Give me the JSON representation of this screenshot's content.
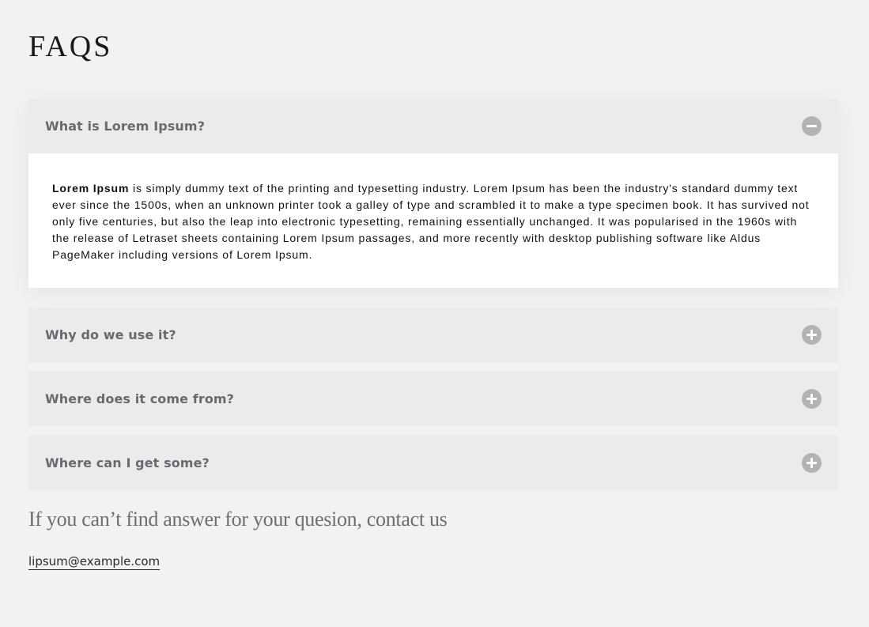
{
  "page": {
    "title": "FAQS"
  },
  "faqs": [
    {
      "question": "What is Lorem Ipsum?",
      "expanded": true,
      "toggle_icon": "minus-circle-icon",
      "answer_lead": "Lorem Ipsum",
      "answer_rest": " is simply dummy text of the printing and typesetting industry. Lorem Ipsum has been the industry's standard dummy text ever since the 1500s, when an unknown printer took a galley of type and scrambled it to make a type specimen book. It has survived not only five centuries, but also the leap into electronic typesetting, remaining essentially unchanged. It was popularised in the 1960s with the release of Letraset sheets containing Lorem Ipsum passages, and more recently with desktop publishing software like Aldus PageMaker including versions of Lorem Ipsum."
    },
    {
      "question": "Why do we use it?",
      "expanded": false,
      "toggle_icon": "plus-circle-icon"
    },
    {
      "question": "Where does it come from?",
      "expanded": false,
      "toggle_icon": "plus-circle-icon"
    },
    {
      "question": "Where can I get some?",
      "expanded": false,
      "toggle_icon": "plus-circle-icon"
    }
  ],
  "contact": {
    "heading": "If you can’t find answer for your quesion, contact us",
    "email": "lipsum@example.com"
  },
  "colors": {
    "background": "#f2f2f2",
    "header_background": "#ebebeb",
    "question_text": "#666b70",
    "icon_background": "#b3b3b3",
    "answer_background": "#ffffff"
  }
}
